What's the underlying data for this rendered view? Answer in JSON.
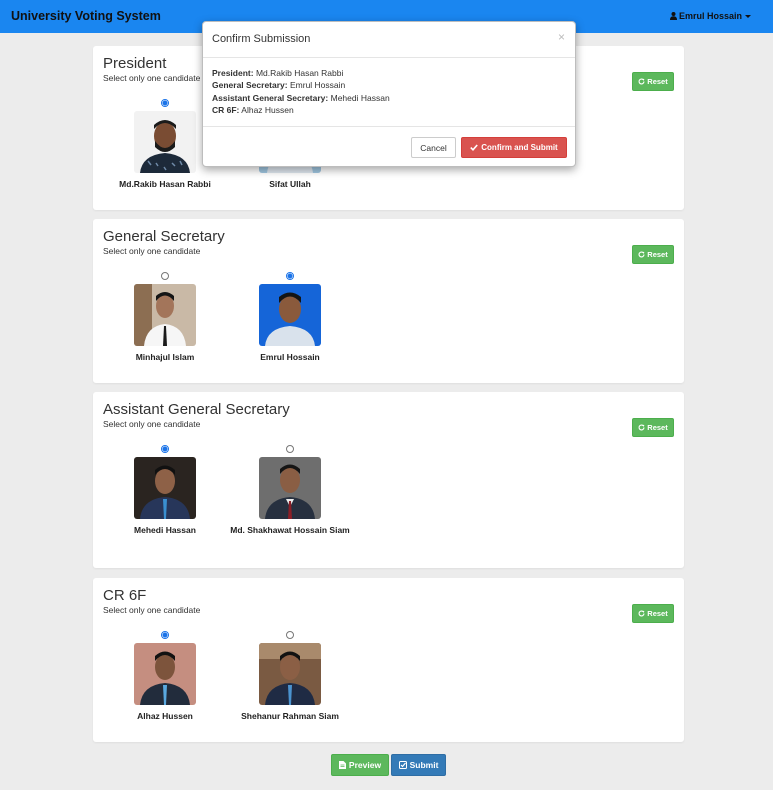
{
  "app": {
    "title": "University Voting System",
    "user": "Emrul Hossain"
  },
  "positions": [
    {
      "title": "President",
      "hint": "Select only one candidate",
      "reset_label": "Reset",
      "candidates": [
        {
          "name": "Md.Rakib Hasan Rabbi",
          "selected": true
        },
        {
          "name": "Sifat Ullah",
          "selected": false
        }
      ]
    },
    {
      "title": "General Secretary",
      "hint": "Select only one candidate",
      "reset_label": "Reset",
      "candidates": [
        {
          "name": "Minhajul Islam",
          "selected": false
        },
        {
          "name": "Emrul Hossain",
          "selected": true
        }
      ]
    },
    {
      "title": "Assistant General Secretary",
      "hint": "Select only one candidate",
      "reset_label": "Reset",
      "candidates": [
        {
          "name": "Mehedi Hassan",
          "selected": true
        },
        {
          "name": "Md. Shakhawat Hossain Siam",
          "selected": false
        }
      ]
    },
    {
      "title": "CR 6F",
      "hint": "Select only one candidate",
      "reset_label": "Reset",
      "candidates": [
        {
          "name": "Alhaz Hussen",
          "selected": true
        },
        {
          "name": "Shehanur Rahman Siam",
          "selected": false
        }
      ]
    }
  ],
  "modal": {
    "title": "Confirm Submission",
    "close": "×",
    "summary": [
      {
        "label": "President:",
        "value": "Md.Rakib Hasan Rabbi"
      },
      {
        "label": "General Secretary:",
        "value": "Emrul Hossain"
      },
      {
        "label": "Assistant General Secretary:",
        "value": "Mehedi Hassan"
      },
      {
        "label": "CR 6F:",
        "value": "Alhaz Hussen"
      }
    ],
    "cancel_label": "Cancel",
    "confirm_label": "Confirm and Submit"
  },
  "actions": {
    "preview_label": "Preview",
    "submit_label": "Submit"
  },
  "colors": {
    "navbar": "#1a86f0",
    "success": "#5cb85c",
    "primary": "#337ab7",
    "danger": "#d9534f"
  }
}
